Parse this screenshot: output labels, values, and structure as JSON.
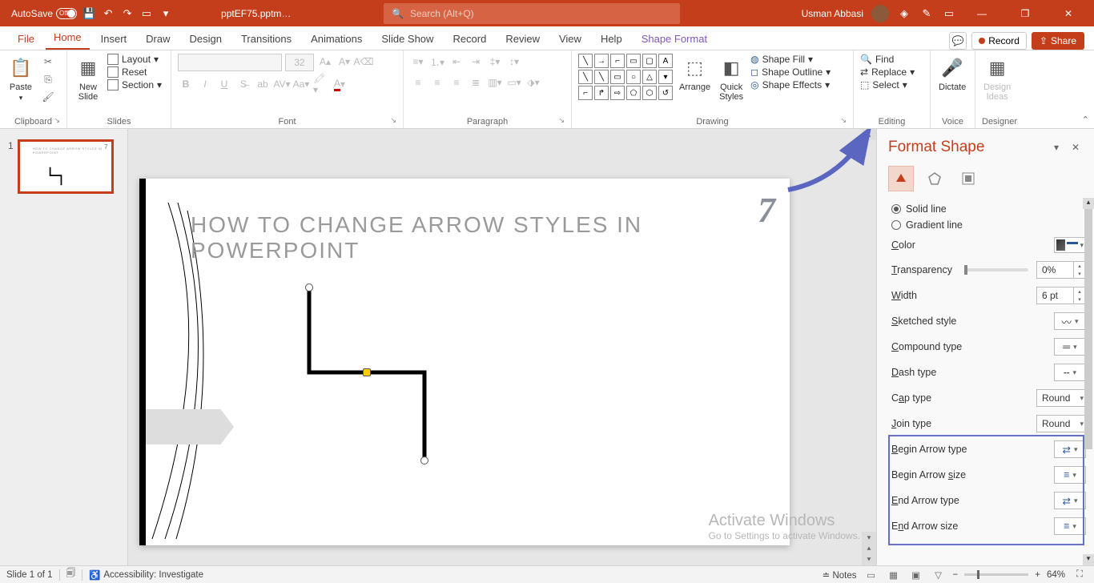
{
  "title_bar": {
    "autosave": "AutoSave",
    "autosave_state": "Off",
    "doc_name": "pptEF75.pptm…",
    "search_placeholder": "Search (Alt+Q)",
    "user": "Usman Abbasi"
  },
  "tabs": {
    "file": "File",
    "home": "Home",
    "insert": "Insert",
    "draw": "Draw",
    "design": "Design",
    "transitions": "Transitions",
    "animations": "Animations",
    "slideshow": "Slide Show",
    "record": "Record",
    "review": "Review",
    "view": "View",
    "help": "Help",
    "shape_format": "Shape Format",
    "record_btn": "Record",
    "share": "Share"
  },
  "ribbon": {
    "clipboard": "Clipboard",
    "paste": "Paste",
    "slides": "Slides",
    "new_slide": "New\nSlide",
    "layout": "Layout",
    "reset": "Reset",
    "section": "Section",
    "font": "Font",
    "font_size": "32",
    "paragraph": "Paragraph",
    "drawing": "Drawing",
    "arrange": "Arrange",
    "quick_styles": "Quick\nStyles",
    "shape_fill": "Shape Fill",
    "shape_outline": "Shape Outline",
    "shape_effects": "Shape Effects",
    "editing": "Editing",
    "find": "Find",
    "replace": "Replace",
    "select": "Select",
    "voice": "Voice",
    "dictate": "Dictate",
    "designer": "Designer",
    "design_ideas": "Design\nIdeas"
  },
  "slide": {
    "num": "1",
    "title": "HOW TO CHANGE ARROW STYLES IN POWERPOINT",
    "seven": "7"
  },
  "pane": {
    "title": "Format Shape",
    "solid": "Solid line",
    "gradient": "Gradient line",
    "color": "Color",
    "transparency": "Transparency",
    "transparency_val": "0%",
    "width": "Width",
    "width_val": "6 pt",
    "sketched": "Sketched style",
    "compound": "Compound type",
    "dash": "Dash type",
    "cap": "Cap type",
    "cap_val": "Round",
    "join": "Join type",
    "join_val": "Round",
    "begin_type": "Begin Arrow type",
    "begin_size": "Begin Arrow size",
    "end_type": "End Arrow type",
    "end_size": "End Arrow size"
  },
  "status": {
    "slide": "Slide 1 of 1",
    "accessibility": "Accessibility: Investigate",
    "notes": "Notes",
    "zoom": "64%"
  },
  "watermark": {
    "t1": "Activate Windows",
    "t2": "Go to Settings to activate Windows."
  }
}
